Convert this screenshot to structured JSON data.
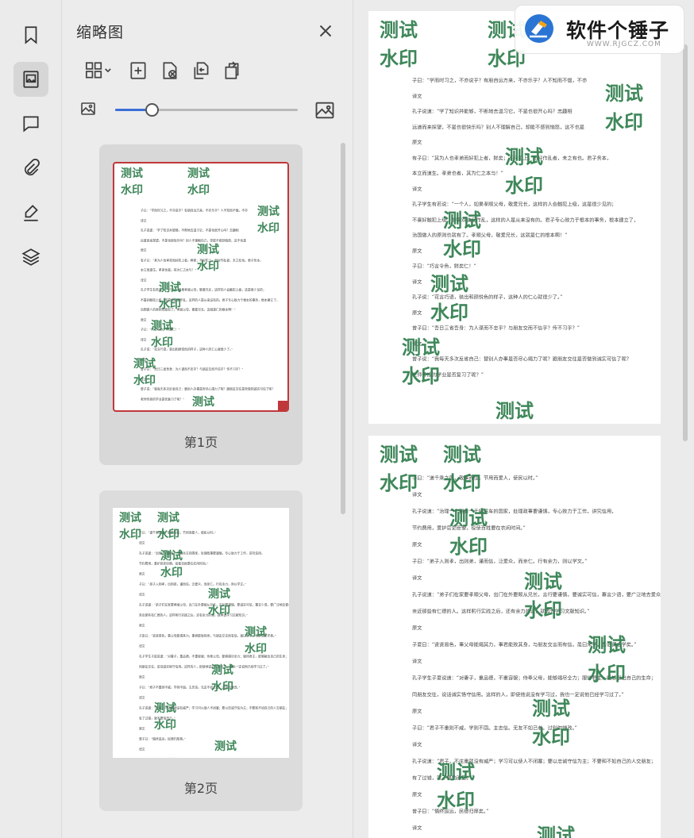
{
  "panel": {
    "title": "缩略图"
  },
  "zoom": {
    "level": 0.2
  },
  "thumbnails": [
    {
      "label": "第1页"
    },
    {
      "label": "第2页"
    }
  ],
  "watermark": {
    "line1": "测试",
    "line2": "水印",
    "color": "#2f7d4d"
  },
  "page1_lines": [
    "子曰：“学而时习之，不亦说乎？有朋自远方来，不亦乐乎？人不知而不愠，不亦",
    "译文",
    "孔子说道：“学了知识并能够，不断地去温习它，不是也很开心吗？志趣相",
    "远道而来探望，不是也很快乐吗？别人不理解自己，却能不感到恼怒，这不也是",
    "原文",
    "有子曰：“其为人也孝弟而好犯上者，鲜矣；不好犯上，而好作乱者，未之有也。君子务本，",
    "本立而道生。孝弟也者，其为仁之本与！”",
    "译文",
    "孔子学生有若说：“一个人，如果孝顺父母，敬爱兄长，这样的人会触犯上级，这是很少见的；",
    "不喜好触犯上级，却喜欢造反作乱，这样的人是从来没有的。君子专心致力于根本的事务，根本建立了，",
    "治国做人的原则也就有了。孝顺父母，敬爱兄长，这就是仁的根本啊！”",
    "原文",
    "子曰：“巧言令色，鲜矣仁！”",
    "译文",
    "孔子说：“花言巧语，装出和颜悦色的样子，这种人的仁心就很少了。”",
    "原文",
    "曾子曰：“吾日三省吾身：为人谋而不忠乎？与朋友交而不信乎？传不习乎？”",
    "译文",
    "曾子说：“我每天多次反省自己：替别人办事是否尽心竭力了呢？跟朋友交往是否做到诚实可信了呢？",
    "老师传授的学业是否复习了呢？”"
  ],
  "page2_lines": [
    "子曰：“道千乘之国，敬事而信，节用而爱人，使民以时。”",
    "译文",
    "孔子说道：“治理一个拥有一千辆兵车的国家，处理政事要谨慎，专心致力于工作，讲究信用，",
    "节约费用，爱护官吏臣僚，役使百姓要在农闲时间。”",
    "原文",
    "子曰：“弟子入则孝，出则弟，谨而信，泛爱众，而亲仁。行有余力，则以学文。”",
    "译文",
    "孔子说道：“弟子们在家要孝顺父母，出门在外要顺从兄长，言行要谨慎，要诚实可信，寡言少语，要广泛地去爱众人，",
    "亲近那些有仁德的人。这样躬行实践之后，还有余力的话，就再去学习文献知识。”",
    "原文",
    "子夏曰：“贤贤易色，事父母能竭其力，事君能致其身，与朋友交言而有信。虽曰未学，吾必谓之学矣。”",
    "译文",
    "孔子学生子夏说道：“对妻子，重品德，不重容貌；侍奉父母，能够竭尽全力；服侍君主，能够献出自己的生命；",
    "同朋友交往，说话诚实恪守信用。这样的人，即使他说没有学习过，我也一定说他已经学习过了。”",
    "原文",
    "子曰：“君子不重则不威，学则不固。主忠信。无友不如己者。过则勿惮改。”",
    "译文",
    "孔子说道：“君子，不庄重就没有威严；学习可以使人不闭塞；要以忠诚守信为主；不要和不如自己的人交朋友；",
    "有了过错，就不要怕改正。”",
    "原文",
    "曾子曰：“慎终追远，民德归厚矣。”",
    "译文",
    "孔子学生曾子说道：“谨慎地对待父母的去世，追念久远的祖先，自然会导致老百姓日趋忠厚老实了。”"
  ],
  "logo": {
    "title": "软件个锤子",
    "url": "WWW.RJGCZ.COM"
  }
}
